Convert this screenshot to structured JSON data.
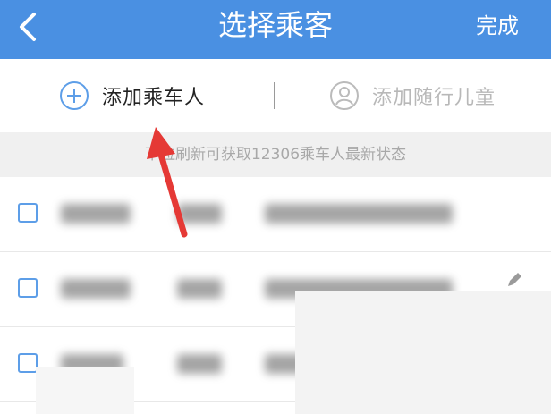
{
  "header": {
    "title": "选择乘客",
    "done_label": "完成"
  },
  "actions": {
    "add_passenger_label": "添加乘车人",
    "add_child_label": "添加随行儿童"
  },
  "hint": {
    "text": "下拉刷新可获取12306乘车人最新状态"
  },
  "colors": {
    "header_bg": "#4a90e2",
    "accent": "#5d9ee8",
    "annotation_arrow": "#e53935"
  }
}
